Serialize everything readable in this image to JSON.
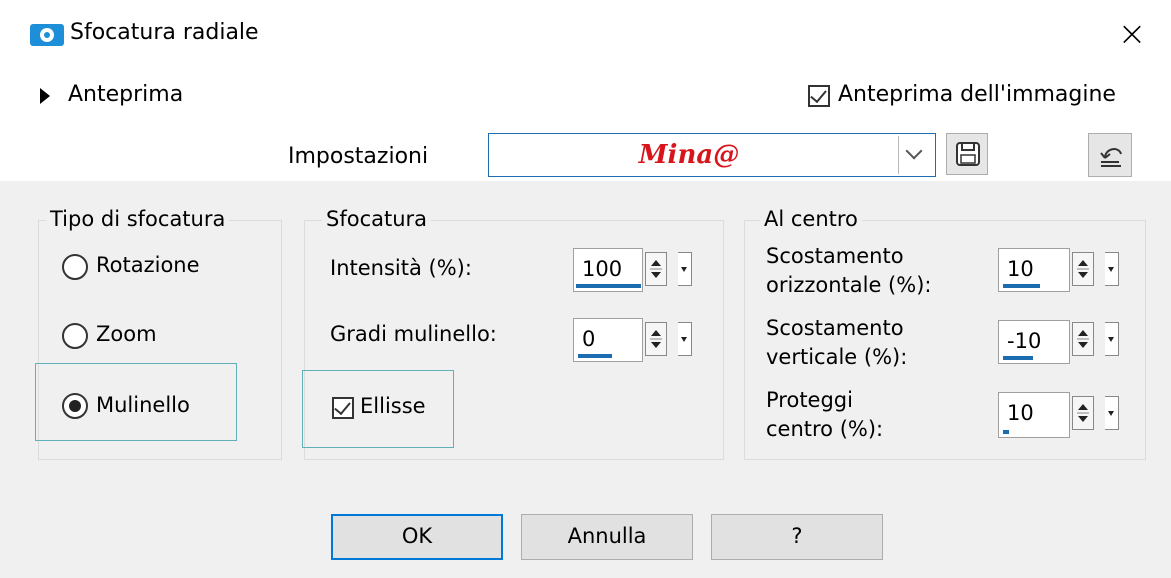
{
  "window": {
    "title": "Sfocatura radiale",
    "close_glyph": "×"
  },
  "preview": {
    "label": "Anteprima",
    "image_preview_label": "Anteprima dell'immagine",
    "image_preview_checked": true
  },
  "settings": {
    "label": "Impostazioni",
    "value": "Mina@"
  },
  "blur_type": {
    "title": "Tipo di sfocatura",
    "options": [
      {
        "label": "Rotazione",
        "selected": false
      },
      {
        "label": "Zoom",
        "selected": false
      },
      {
        "label": "Mulinello",
        "selected": true
      }
    ]
  },
  "blur": {
    "title": "Sfocatura",
    "intensity_label": "Intensità (%):",
    "intensity_value": "100",
    "intensity_fraction": 1.0,
    "twirl_label": "Gradi mulinello:",
    "twirl_value": "0",
    "twirl_fraction": 0.5,
    "ellipse_label": "Ellisse",
    "ellipse_checked": true
  },
  "center": {
    "title": "Al centro",
    "h_offset_label_1": "Scostamento",
    "h_offset_label_2": "orizzontale (%):",
    "h_offset_value": "10",
    "h_offset_fraction": 0.55,
    "v_offset_label_1": "Scostamento",
    "v_offset_label_2": "verticale (%):",
    "v_offset_value": "-10",
    "v_offset_fraction": 0.45,
    "protect_label_1": "Proteggi",
    "protect_label_2": "centro (%):",
    "protect_value": "10",
    "protect_fraction": 0.1
  },
  "buttons": {
    "ok": "OK",
    "cancel": "Annulla",
    "help": "?"
  },
  "colors": {
    "accent": "#0078d7",
    "preset_text": "#d7161c",
    "camera_icon": "#1d8fd8"
  }
}
